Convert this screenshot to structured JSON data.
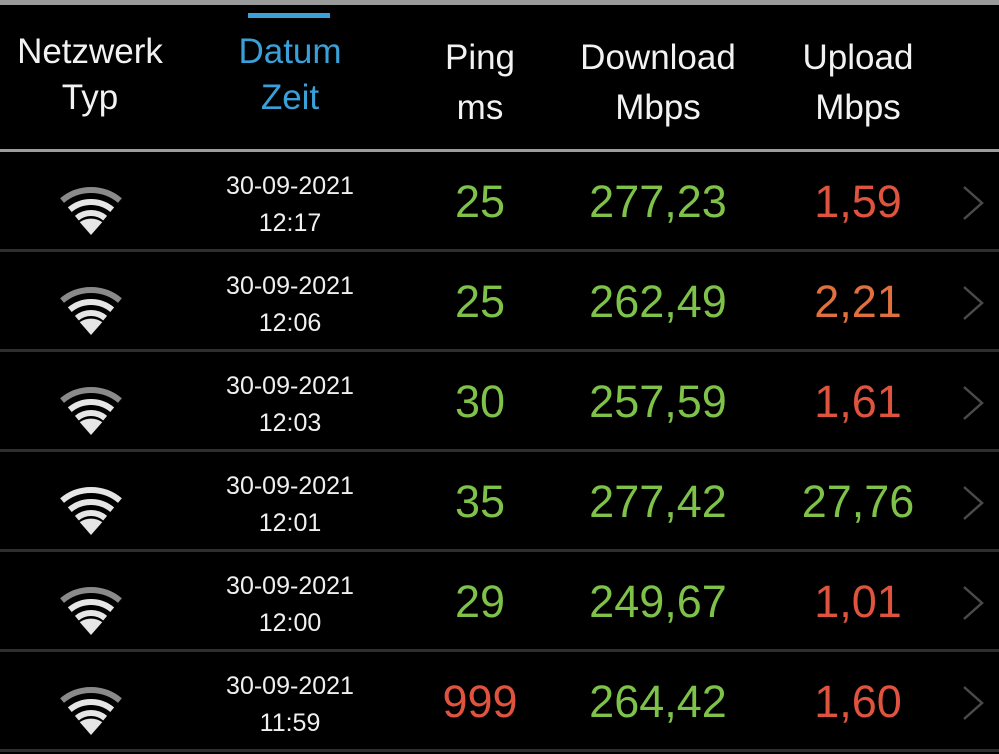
{
  "colors": {
    "good": "#7ec24a",
    "bad": "#e0533e",
    "warn": "#e0713e",
    "accent": "#3aa0d8"
  },
  "header": {
    "columns": [
      {
        "line1": "Netzwerk",
        "line2": "Typ",
        "active": false
      },
      {
        "line1": "Datum",
        "line2": "Zeit",
        "active": true
      },
      {
        "line1": "Ping",
        "line2": "ms",
        "active": false
      },
      {
        "line1": "Download",
        "line2": "Mbps",
        "active": false
      },
      {
        "line1": "Upload",
        "line2": "Mbps",
        "active": false
      }
    ]
  },
  "rows": [
    {
      "network_icon": "wifi-icon",
      "wifi_signal_bars": 3,
      "date": "30-09-2021",
      "time": "12:17",
      "ping": "25",
      "ping_status": "good",
      "download": "277,23",
      "download_status": "good",
      "upload": "1,59",
      "upload_status": "bad"
    },
    {
      "network_icon": "wifi-icon",
      "wifi_signal_bars": 3,
      "date": "30-09-2021",
      "time": "12:06",
      "ping": "25",
      "ping_status": "good",
      "download": "262,49",
      "download_status": "good",
      "upload": "2,21",
      "upload_status": "warn"
    },
    {
      "network_icon": "wifi-icon",
      "wifi_signal_bars": 3,
      "date": "30-09-2021",
      "time": "12:03",
      "ping": "30",
      "ping_status": "good",
      "download": "257,59",
      "download_status": "good",
      "upload": "1,61",
      "upload_status": "bad"
    },
    {
      "network_icon": "wifi-icon",
      "wifi_signal_bars": 4,
      "date": "30-09-2021",
      "time": "12:01",
      "ping": "35",
      "ping_status": "good",
      "download": "277,42",
      "download_status": "good",
      "upload": "27,76",
      "upload_status": "good"
    },
    {
      "network_icon": "wifi-icon",
      "wifi_signal_bars": 3,
      "date": "30-09-2021",
      "time": "12:00",
      "ping": "29",
      "ping_status": "good",
      "download": "249,67",
      "download_status": "good",
      "upload": "1,01",
      "upload_status": "bad"
    },
    {
      "network_icon": "wifi-icon",
      "wifi_signal_bars": 3,
      "date": "30-09-2021",
      "time": "11:59",
      "ping": "999",
      "ping_status": "bad",
      "download": "264,42",
      "download_status": "good",
      "upload": "1,60",
      "upload_status": "bad"
    }
  ]
}
